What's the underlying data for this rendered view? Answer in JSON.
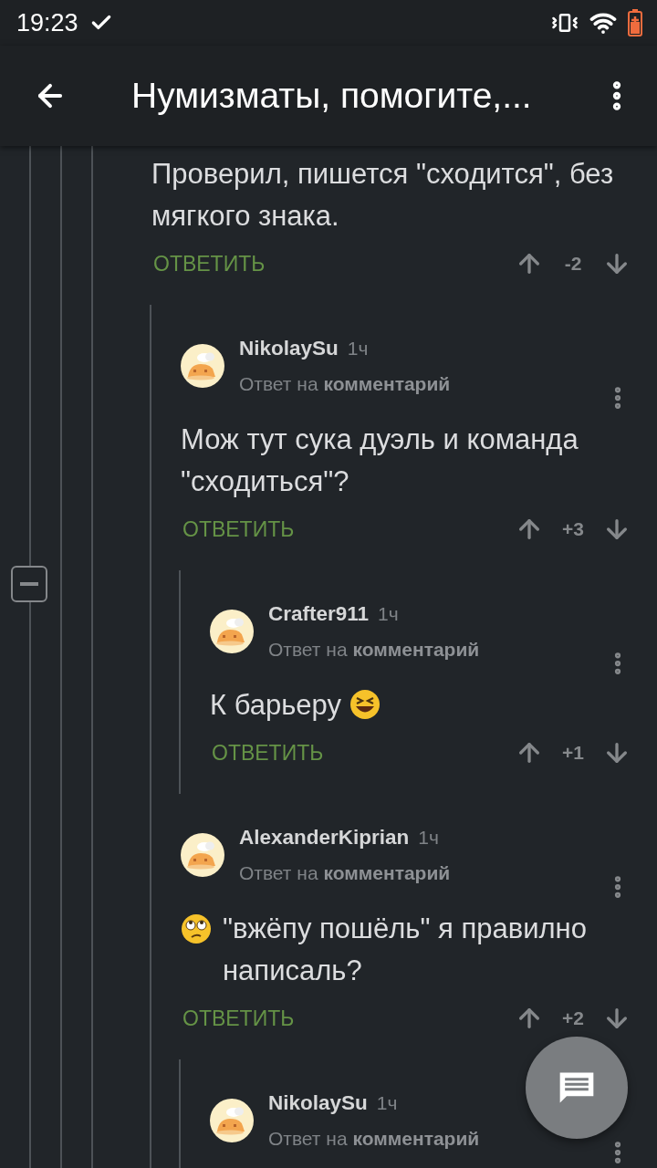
{
  "status_bar": {
    "time": "19:23"
  },
  "app_bar": {
    "title": "Нумизматы, помогите,..."
  },
  "comments": [
    {
      "body": "Проверил, пишется \"сходится\", без мягкого знака.",
      "reply": "ОТВЕТИТЬ",
      "score": "-2",
      "children": [
        {
          "author": "NikolaySu",
          "time": "1ч",
          "subtitle": "Ответ на **комментарий**",
          "body": "Мож тут сука дуэль и команда \"сходиться\"?",
          "reply": "ОТВЕТИТЬ",
          "score": "+3",
          "children": [
            {
              "author": "Crafter911",
              "time": "1ч",
              "subtitle": "Ответ на **комментарий**",
              "body": "К барьеру",
              "trail_emoji": {
                "kind": "laughing"
              },
              "reply": "ОТВЕТИТЬ",
              "score": "+1"
            }
          ]
        },
        {
          "author": "AlexanderKiprian",
          "time": "1ч",
          "subtitle": "Ответ на **комментарий**",
          "body": "\"вжёпу пошёль\" я правилно написаль?",
          "lead_emoji": {
            "kind": "eye-roll"
          },
          "reply": "ОТВЕТИТЬ",
          "score": "+2",
          "children": [
            {
              "author": "NikolaySu",
              "time": "1ч",
              "subtitle": "Ответ на **комментарий**"
            }
          ]
        }
      ]
    }
  ]
}
